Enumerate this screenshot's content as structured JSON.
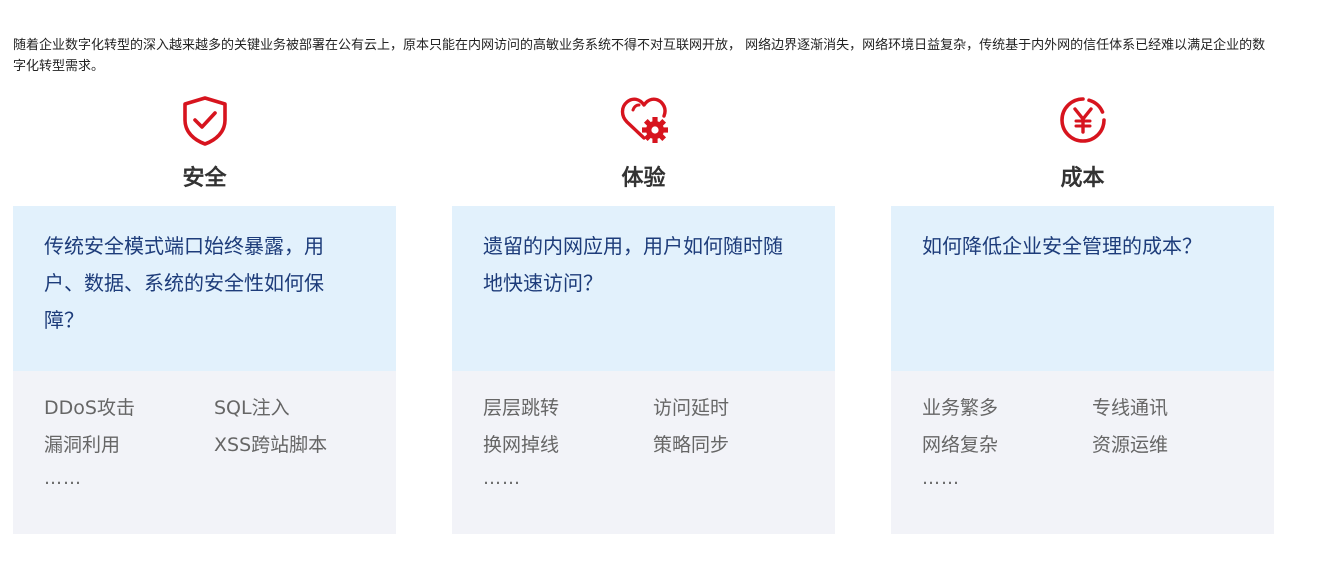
{
  "intro": {
    "text": "随着企业数字化转型的深入越来越多的关键业务被部署在公有云上，原本只能在内网访问的高敏业务系统不得不对互联网开放， 网络边界逐渐消失，网络环境日益复杂，传统基于内外网的信任体系已经难以满足企业的数字化转型需求。"
  },
  "colors": {
    "accent_red": "#d7141e",
    "question_bg": "#e2f1fc",
    "question_text": "#1d3c7a",
    "issues_bg": "#f2f3f8"
  },
  "cards": [
    {
      "icon": "shield-check-icon",
      "title": "安全",
      "question": "传统安全模式端口始终暴露，用户、数据、系统的安全性如何保障？",
      "issues": [
        "DDoS攻击",
        "SQL注入",
        "漏洞利用",
        "XSS跨站脚本"
      ],
      "more": "……"
    },
    {
      "icon": "heart-gear-icon",
      "title": "体验",
      "question": "遗留的内网应用，用户如何随时随地快速访问？",
      "issues": [
        "层层跳转",
        "访问延时",
        "换网掉线",
        "策略同步"
      ],
      "more": "……"
    },
    {
      "icon": "yen-circle-icon",
      "title": "成本",
      "question": "如何降低企业安全管理的成本？",
      "issues": [
        "业务繁多",
        "专线通讯",
        "网络复杂",
        "资源运维"
      ],
      "more": "……"
    }
  ]
}
